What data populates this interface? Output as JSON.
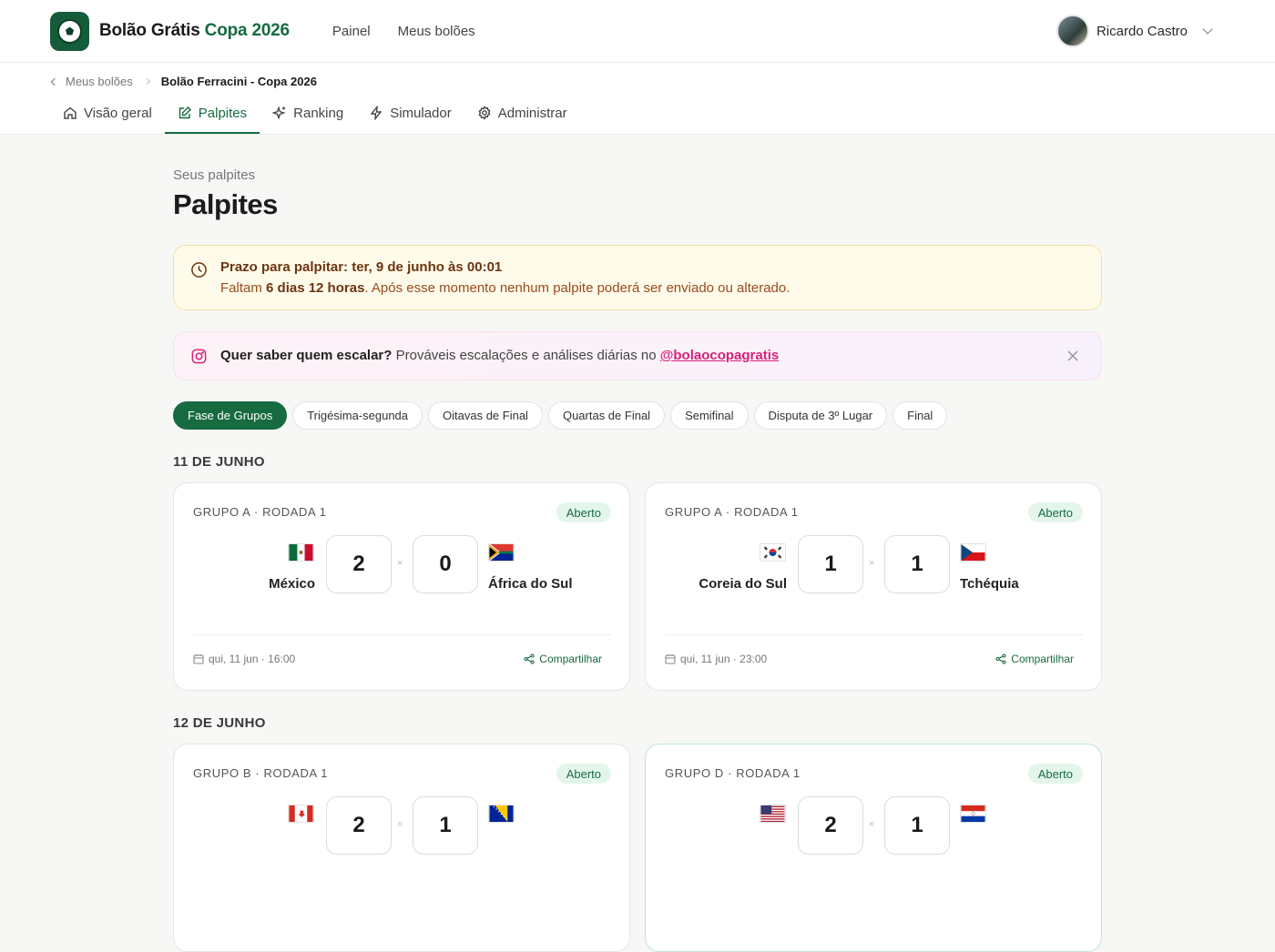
{
  "header": {
    "brand_part1": "Bolão Grátis",
    "brand_part2": "Copa 2026",
    "nav": [
      "Painel",
      "Meus bolões"
    ],
    "user_name": "Ricardo Castro"
  },
  "breadcrumb": {
    "parent": "Meus bolões",
    "current": "Bolão Ferracini - Copa 2026"
  },
  "tabs": [
    {
      "label": "Visão geral",
      "icon": "home-icon"
    },
    {
      "label": "Palpites",
      "icon": "edit-icon"
    },
    {
      "label": "Ranking",
      "icon": "sparkle-icon"
    },
    {
      "label": "Simulador",
      "icon": "bolt-icon"
    },
    {
      "label": "Administrar",
      "icon": "gear-icon"
    }
  ],
  "page": {
    "eyebrow": "Seus palpites",
    "title": "Palpites"
  },
  "deadline": {
    "title": "Prazo para palpitar: ter, 9 de junho às 00:01",
    "prefix": "Faltam",
    "remaining": "6 dias 12 horas",
    "suffix": ". Após esse momento nenhum palpite poderá ser enviado ou alterado."
  },
  "promo": {
    "bold": "Quer saber quem escalar?",
    "text": " Prováveis escalações e análises diárias no ",
    "handle": "@bolaocopagratis"
  },
  "phases": [
    "Fase de Grupos",
    "Trigésima-segunda",
    "Oitavas de Final",
    "Quartas de Final",
    "Semifinal",
    "Disputa de 3º Lugar",
    "Final"
  ],
  "days": [
    {
      "date": "11 DE JUNHO",
      "matches": [
        {
          "round": "GRUPO A · RODADA 1",
          "status": "Aberto",
          "home": "México",
          "away": "África do Sul",
          "home_score": "2",
          "away_score": "0",
          "sep": "×",
          "when": "qui, 11 jun · 16:00",
          "share": "Compartilhar"
        },
        {
          "round": "GRUPO A · RODADA 1",
          "status": "Aberto",
          "home": "Coreia do Sul",
          "away": "Tchéquia",
          "home_score": "1",
          "away_score": "1",
          "sep": "×",
          "when": "qui, 11 jun · 23:00",
          "share": "Compartilhar"
        }
      ]
    },
    {
      "date": "12 DE JUNHO",
      "matches": [
        {
          "round": "GRUPO B · RODADA 1",
          "status": "Aberto",
          "home": "",
          "away": "",
          "home_score": "2",
          "away_score": "1",
          "sep": "×"
        },
        {
          "round": "GRUPO D · RODADA 1",
          "status": "Aberto",
          "home": "",
          "away": "",
          "home_score": "2",
          "away_score": "1",
          "sep": "×"
        }
      ]
    }
  ],
  "colors": {
    "brand_green": "#166b40",
    "deadline_bg": "#fffbea",
    "promo_pink": "#d6237a"
  }
}
